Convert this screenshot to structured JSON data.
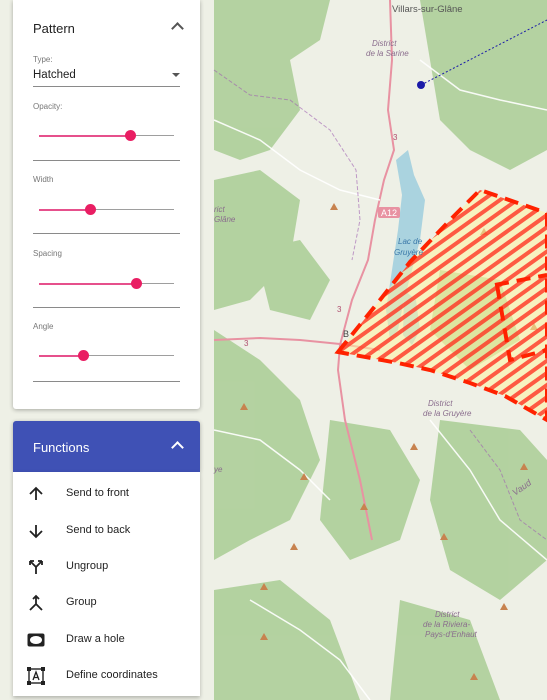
{
  "map": {
    "labels": {
      "town_top": "Villars-sur-Glâne",
      "district_sarine_1": "District",
      "district_sarine_2": "de la Sarine",
      "road_a12": "A12",
      "road_3": "3",
      "road_3b": "3",
      "road_3c": "3",
      "lac_1": "Lac de",
      "lac_2": "Gruyère",
      "bulle_1": "B",
      "bulle_2": "e",
      "glane_1": "rict",
      "glane_2": "Glâne",
      "gruyere_1": "District",
      "gruyere_2": "de la Gruyère",
      "riviera_1": "District",
      "riviera_2": "de la Riviera-",
      "riviera_3": "Pays-d'Enhaut",
      "vaud": "Vaud",
      "left_ye": "ye"
    },
    "colors": {
      "background": "#eef0e6",
      "forest": "#a9cd94",
      "water": "#aad3df",
      "road": "#e892a2",
      "pattern": "#ff2200",
      "outline": "#ff2200",
      "border": "#9e5fb0",
      "marker": "#1a1aa8"
    }
  },
  "pattern_panel": {
    "title": "Pattern",
    "type_label": "Type:",
    "type_value": "Hatched",
    "opacity_label": "Opacity:",
    "opacity_value": 0.68,
    "width_label": "Width",
    "width_value": 0.38,
    "spacing_label": "Spacing",
    "spacing_value": 0.72,
    "angle_label": "Angle",
    "angle_value": 0.33
  },
  "functions_panel": {
    "title": "Functions",
    "accent_color": "#3f51b5",
    "items": [
      {
        "label": "Send to front",
        "icon": "arrow-up-icon"
      },
      {
        "label": "Send to back",
        "icon": "arrow-down-icon"
      },
      {
        "label": "Ungroup",
        "icon": "ungroup-icon"
      },
      {
        "label": "Group",
        "icon": "group-icon"
      },
      {
        "label": "Draw a hole",
        "icon": "hole-icon"
      },
      {
        "label": "Define coordinates",
        "icon": "coordinates-icon"
      }
    ]
  }
}
